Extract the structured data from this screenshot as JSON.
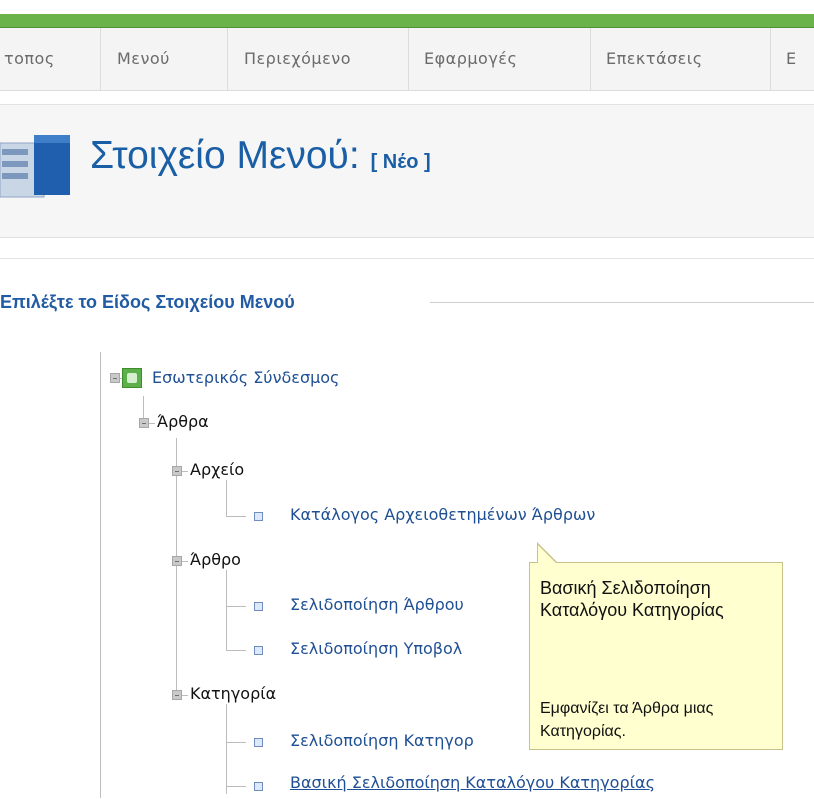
{
  "menu": {
    "items": [
      {
        "label": "τοπος"
      },
      {
        "label": "Μενού"
      },
      {
        "label": "Περιεχόμενο"
      },
      {
        "label": "Εφαρμογές"
      },
      {
        "label": "Επεκτάσεις"
      },
      {
        "label": "Ε"
      }
    ]
  },
  "header": {
    "title": "Στοιχείο Μενού:",
    "subtitle": "[ Νέο ]"
  },
  "fieldset": {
    "legend": "Επιλέξτε το Είδος Στοιχείου Μενού"
  },
  "tree": {
    "root": "Εσωτερικός Σύνδεσμος",
    "articles": "Άρθρα",
    "archive": "Αρχείο",
    "archive_list": "Κατάλογος Αρχειοθετημένων Άρθρων",
    "article": "Άρθρο",
    "article_layout": "Σελιδοποίηση Άρθρου",
    "article_submit": "Σελιδοποίηση Υποβολ",
    "category": "Κατηγορία",
    "category_layout": "Σελιδοποίηση Κατηγορ",
    "category_list": "Βασική Σελιδοποίηση Καταλόγου Κατηγορίας"
  },
  "tooltip": {
    "title": "Βασική Σελιδοποίηση Καταλόγου Κατηγορίας",
    "description": "Εμφανίζει τα Άρθρα μιας Κατηγορίας."
  },
  "colors": {
    "accent": "#6ab34a",
    "title": "#1a5fa6",
    "link": "#1f4f94",
    "tooltip_bg": "#ffffcf"
  },
  "icons": {
    "header": "menu-item-icon",
    "root": "green-square-icon"
  }
}
